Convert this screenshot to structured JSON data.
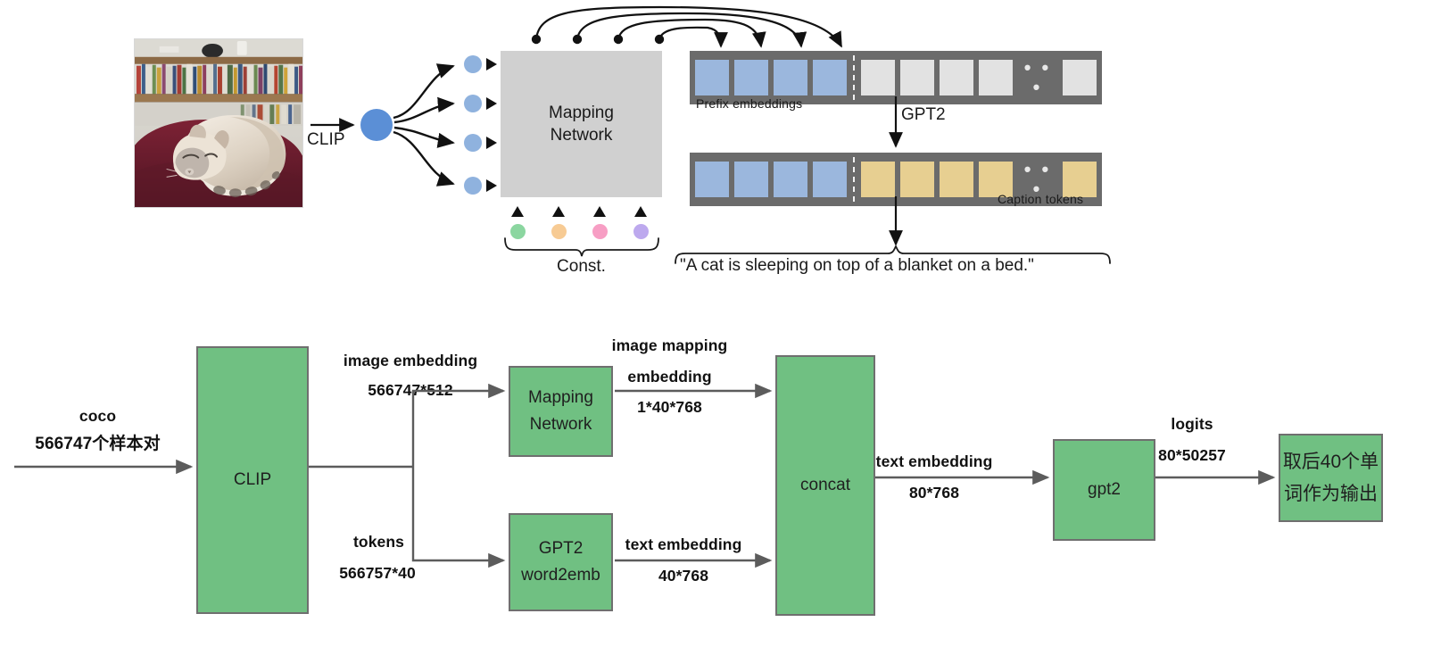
{
  "top_figure": {
    "image_alt": "sleeping cat on a maroon blanket in front of a bookshelf",
    "clip_label": "CLIP",
    "mapping_network_line1": "Mapping",
    "mapping_network_line2": "Network",
    "const_label": "Const.",
    "prefix_label": "Prefix embeddings",
    "gpt2_label": "GPT2",
    "caption_tokens_label": "Caption tokens",
    "caption_text": "\"A cat is sleeping on top of a blanket on a bed.\"",
    "const_colors": [
      "#8bd6a0",
      "#f7cb94",
      "#f79ec4",
      "#bda9ee"
    ],
    "prefix_cell_color": "#9bb7dd",
    "empty_cell_color": "#e2e2e2",
    "caption_cell_color": "#e7cf91",
    "strip_bg_color": "#6b6b6b",
    "dots_glyph": "• • •",
    "row1_cells": [
      "blue",
      "blue",
      "blue",
      "blue",
      "grey",
      "grey",
      "grey",
      "grey",
      "dots",
      "grey"
    ],
    "row2_cells": [
      "blue",
      "blue",
      "blue",
      "blue",
      "tan",
      "tan",
      "tan",
      "tan",
      "dots",
      "tan"
    ]
  },
  "bottom_figure": {
    "accent_green": "#70c082",
    "boxes": {
      "clip": "CLIP",
      "mapping_network_line1": "Mapping",
      "mapping_network_line2": "Network",
      "gpt2_word2emb_line1": "GPT2",
      "gpt2_word2emb_line2": "word2emb",
      "concat": "concat",
      "gpt2": "gpt2",
      "output_line1": "取后40个单",
      "output_line2": "词作为输出"
    },
    "edges": {
      "input_name": "coco",
      "input_shape": "566747个样本对",
      "image_embedding_name": "image embedding",
      "image_embedding_shape": "566747*512",
      "tokens_name": "tokens",
      "tokens_shape": "566757*40",
      "image_mapping_name_line1": "image mapping",
      "image_mapping_name_line2": "embedding",
      "image_mapping_shape": "1*40*768",
      "text_embedding_name": "text embedding",
      "text_embedding_shape": "40*768",
      "concat_out_name": "text embedding",
      "concat_out_shape": "80*768",
      "logits_name": "logits",
      "logits_shape": "80*50257"
    }
  }
}
